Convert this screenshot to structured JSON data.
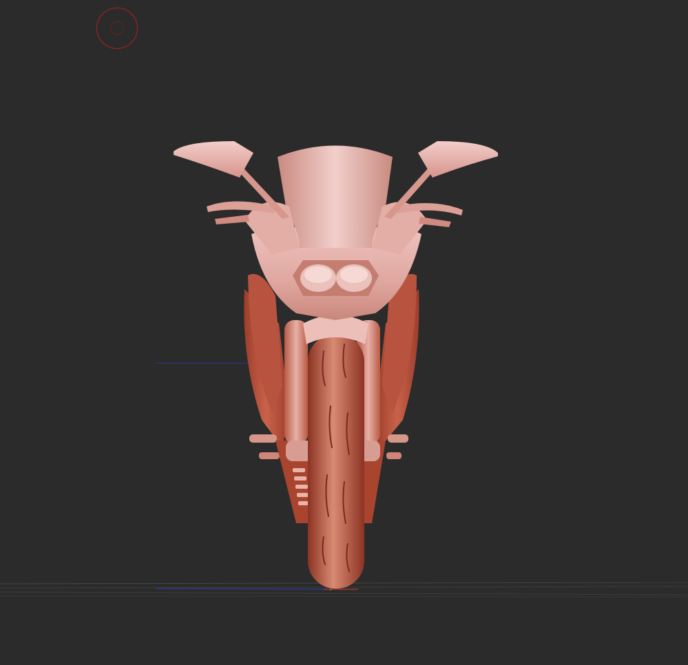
{
  "viewport": {
    "background_color": "#2b2b2b",
    "model_color_light": "#e8b5b0",
    "model_color_mid": "#c96a52",
    "model_color_dark": "#8a3526",
    "brush_color": "#b32020",
    "axis_blue": "#2a3a8c",
    "axis_green": "#4caf50",
    "axis_red": "#c0392b"
  },
  "model": {
    "icon": "motorcycle-sculpt-front-view"
  },
  "brush": {
    "icon": "brush-circle-cursor"
  }
}
